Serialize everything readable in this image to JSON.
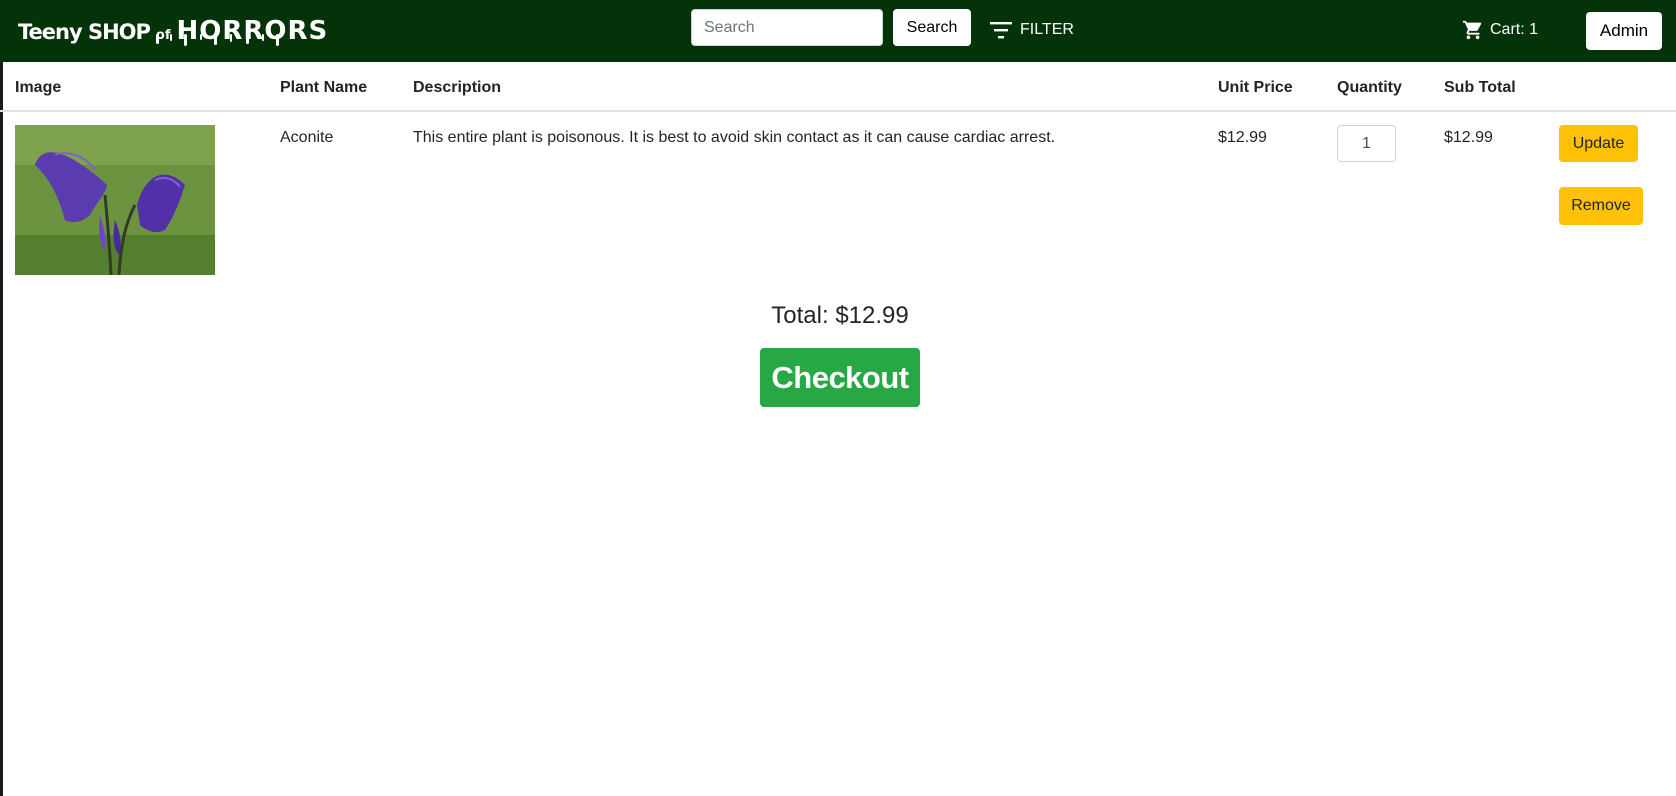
{
  "brand": {
    "part1": "Teeny SHOP",
    "part2": "of",
    "part3": "HORRORS"
  },
  "search": {
    "placeholder": "Search",
    "button_label": "Search"
  },
  "filter": {
    "label": "FILTER"
  },
  "cart": {
    "label": "Cart: 1"
  },
  "admin": {
    "label": "Admin"
  },
  "table": {
    "headers": [
      "Image",
      "Plant Name",
      "Description",
      "Unit Price",
      "Quantity",
      "Sub Total"
    ],
    "rows": [
      {
        "plant_name": "Aconite",
        "description": "This entire plant is poisonous. It is best to avoid skin contact as it can cause cardiac arrest.",
        "unit_price": "$12.99",
        "quantity": "1",
        "sub_total": "$12.99",
        "update_label": "Update",
        "remove_label": "Remove"
      }
    ]
  },
  "total": {
    "label": "Total: $12.99"
  },
  "checkout": {
    "label": "Checkout"
  },
  "colors": {
    "navbar": "#04330a",
    "warning": "#ffc107",
    "success": "#28a745"
  }
}
